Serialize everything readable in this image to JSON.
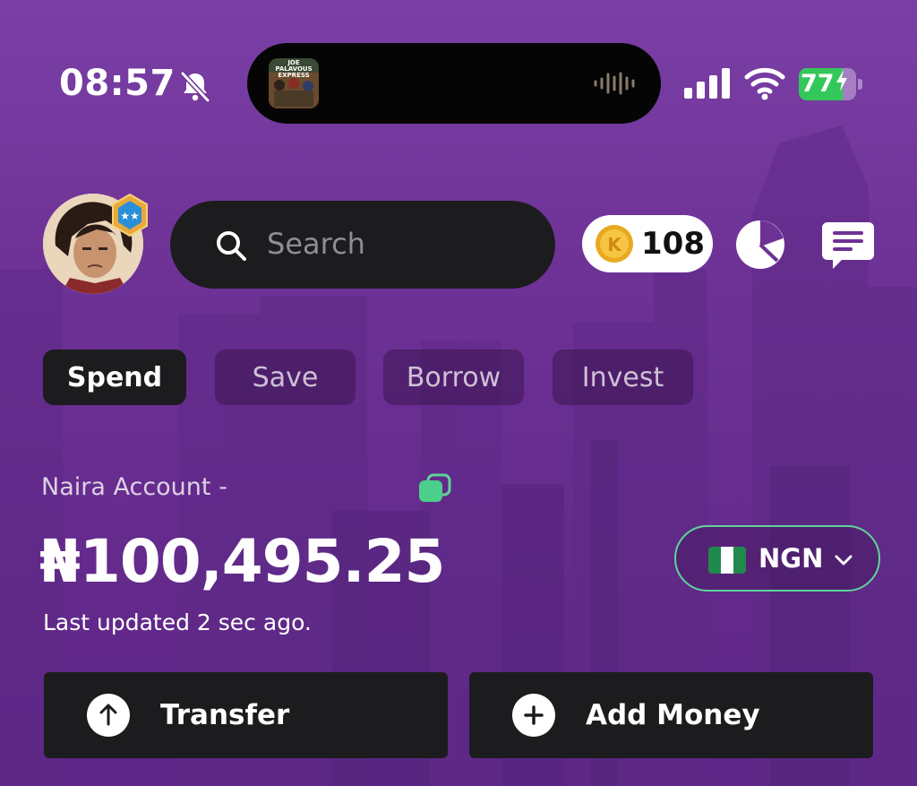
{
  "status_bar": {
    "time": "08:57",
    "battery_percent": "77",
    "battery_level": 0.77,
    "accent_green": "#34c759"
  },
  "now_playing": {
    "album_art_title": "JOE PALAVOUS EXPRESS",
    "icon": "waveform-icon"
  },
  "header": {
    "search_placeholder": "Search",
    "coin_count": "108",
    "icons": [
      "avatar",
      "rank-badge-icon",
      "search-icon",
      "coin-icon",
      "pie-chart-icon",
      "message-icon"
    ]
  },
  "tabs": [
    {
      "label": "Spend",
      "active": true
    },
    {
      "label": "Save",
      "active": false
    },
    {
      "label": "Borrow",
      "active": false
    },
    {
      "label": "Invest",
      "active": false
    }
  ],
  "account": {
    "label": "Naira Account - ",
    "balance": "₦100,495.25",
    "updated": "Last updated 2 sec ago.",
    "currency_code": "NGN",
    "flag": "nigeria-flag-icon",
    "accent": "#5fd39a"
  },
  "actions": [
    {
      "label": "Transfer",
      "icon": "arrow-up-icon"
    },
    {
      "label": "Add Money",
      "icon": "plus-icon"
    }
  ],
  "colors": {
    "background": "#6e3296",
    "panel": "#1c1c1e",
    "brand_purple": "#7a3fa6"
  }
}
